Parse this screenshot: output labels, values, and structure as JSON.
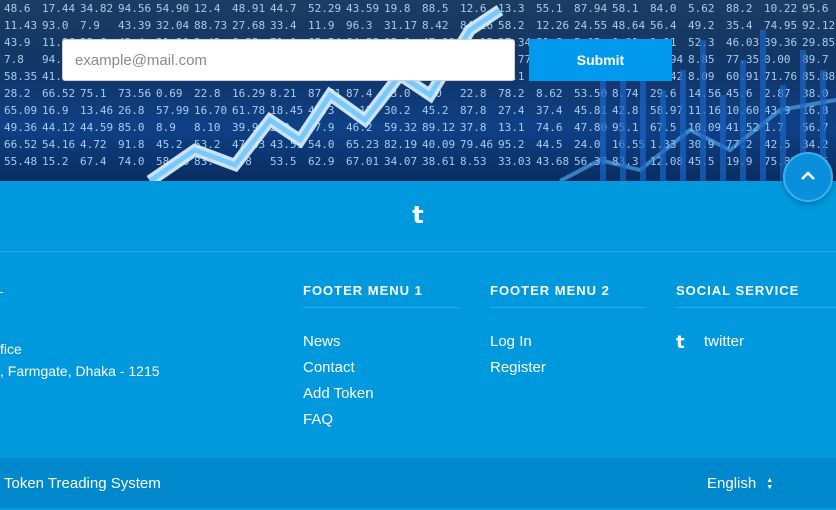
{
  "subscribe": {
    "placeholder": "example@mail.com",
    "submit_label": "Submit"
  },
  "scroll_top": {
    "icon": "chevron-up-icon"
  },
  "footer": {
    "logo_char": "t",
    "address": {
      "line1": "fice",
      "line2": ", Farmgate, Dhaka - 1215"
    },
    "menu1": {
      "title": "FOOTER MENU 1",
      "items": [
        "News",
        "Contact",
        "Add Token",
        "FAQ"
      ]
    },
    "menu2": {
      "title": "FOOTER MENU 2",
      "items": [
        "Log In",
        "Register"
      ]
    },
    "social": {
      "title": "SOCIAL SERVICE",
      "items": [
        {
          "icon": "tumblr-icon",
          "glyph": "t",
          "label": "twitter"
        }
      ]
    }
  },
  "bottom_bar": {
    "copyright": "Token Treading System",
    "language": "English"
  },
  "colors": {
    "footer_bg": "#0099dd",
    "bottom_bg": "#0088cc",
    "submit_bg": "#0099ee"
  }
}
